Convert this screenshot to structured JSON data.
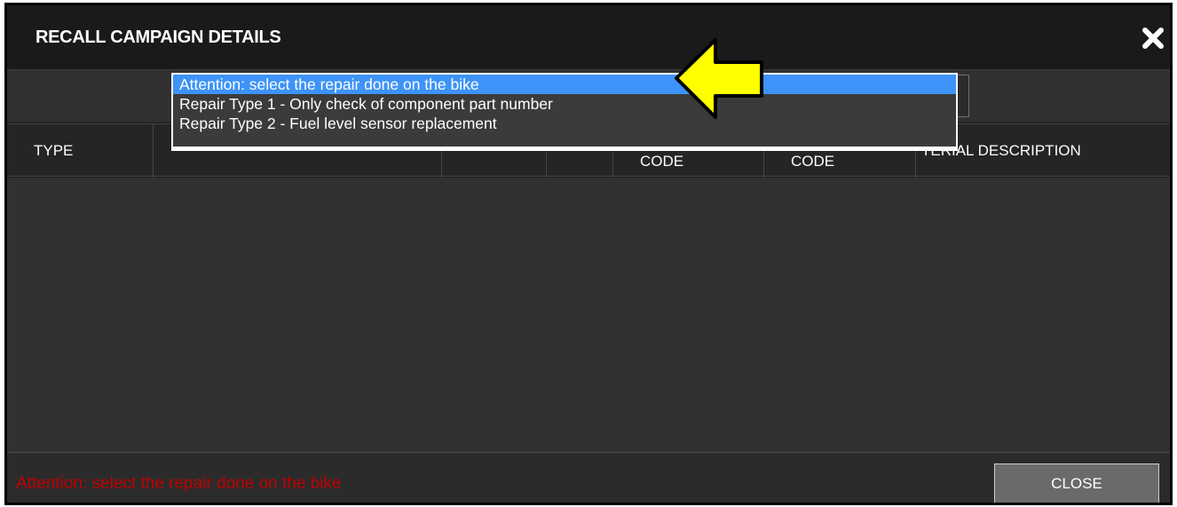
{
  "dialog": {
    "title": "RECALL CAMPAIGN DETAILS",
    "close_icon": "close-x-icon"
  },
  "repair_select": {
    "options": [
      "Attention: select the repair done on the bike",
      "Repair Type 1 - Only check of component part number",
      "Repair Type 2 - Fuel level sensor replacement"
    ],
    "selected_index": 0
  },
  "table": {
    "headers": {
      "type": "TYPE",
      "code1": "CODE",
      "code2": "CODE",
      "material_description": "TERIAL DESCRIPTION"
    },
    "rows": []
  },
  "footer": {
    "attention_text": "Attention: select the repair done on the bike",
    "close_label": "CLOSE"
  },
  "annotation": {
    "arrow_icon": "yellow-arrow-icon",
    "arrow_color": "#ffff00"
  },
  "colors": {
    "highlight": "#3d93f7",
    "warning": "#c00000"
  }
}
